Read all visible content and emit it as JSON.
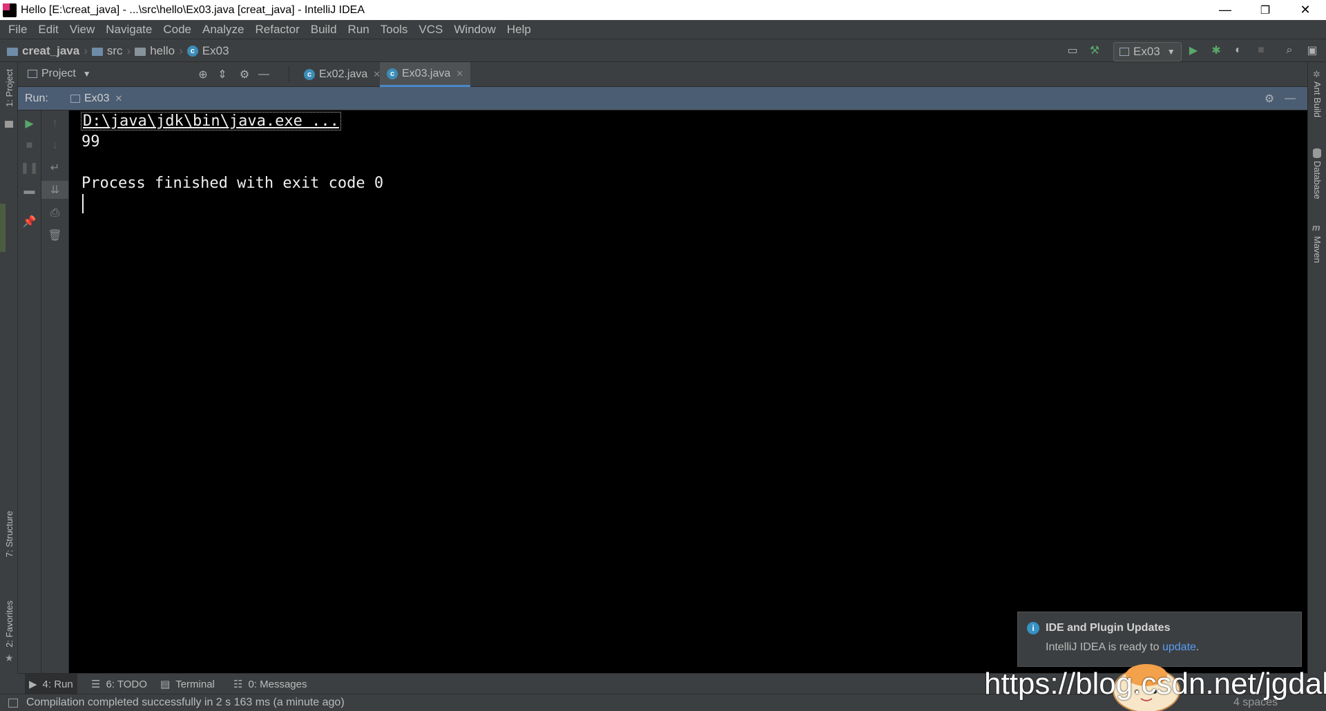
{
  "window": {
    "title": "Hello [E:\\creat_java] - ...\\src\\hello\\Ex03.java [creat_java] - IntelliJ IDEA",
    "minimize": "—",
    "maximize": "❐",
    "close": "✕"
  },
  "menu": [
    "File",
    "Edit",
    "View",
    "Navigate",
    "Code",
    "Analyze",
    "Refactor",
    "Build",
    "Run",
    "Tools",
    "VCS",
    "Window",
    "Help"
  ],
  "breadcrumb": {
    "project": "creat_java",
    "src": "src",
    "package": "hello",
    "file": "Ex03"
  },
  "toolbar": {
    "run_config": "Ex03"
  },
  "left_stripe": {
    "project": "1: Project",
    "structure": "7: Structure",
    "favorites": "2: Favorites"
  },
  "right_stripe": {
    "ant": "Ant Build",
    "database": "Database",
    "maven": "Maven"
  },
  "project_panel": {
    "label": "Project"
  },
  "editor_tabs": [
    {
      "label": "Ex02.java",
      "active": false
    },
    {
      "label": "Ex03.java",
      "active": true
    }
  ],
  "run_panel": {
    "label": "Run:",
    "tab": "Ex03"
  },
  "console": {
    "command": "D:\\java\\jdk\\bin\\java.exe ...",
    "output": "99",
    "finished": "Process finished with exit code 0"
  },
  "notification": {
    "title": "IDE and Plugin Updates",
    "body_prefix": "IntelliJ IDEA is ready to ",
    "link": "update",
    "body_suffix": "."
  },
  "bottom_tabs": [
    {
      "label": "4: Run",
      "icon": "run-icon"
    },
    {
      "label": "6: TODO",
      "icon": "todo-icon"
    },
    {
      "label": "Terminal",
      "icon": "terminal-icon"
    },
    {
      "label": "0: Messages",
      "icon": "messages-icon"
    }
  ],
  "status": {
    "message": "Compilation completed successfully in 2 s 163 ms (a minute ago)",
    "indent": "4 spaces"
  },
  "watermark": "https://blog.csdn.net/jgdabc",
  "colors": {
    "run_green": "#59a869",
    "accent_blue": "#4a88c7",
    "link": "#589df6"
  }
}
